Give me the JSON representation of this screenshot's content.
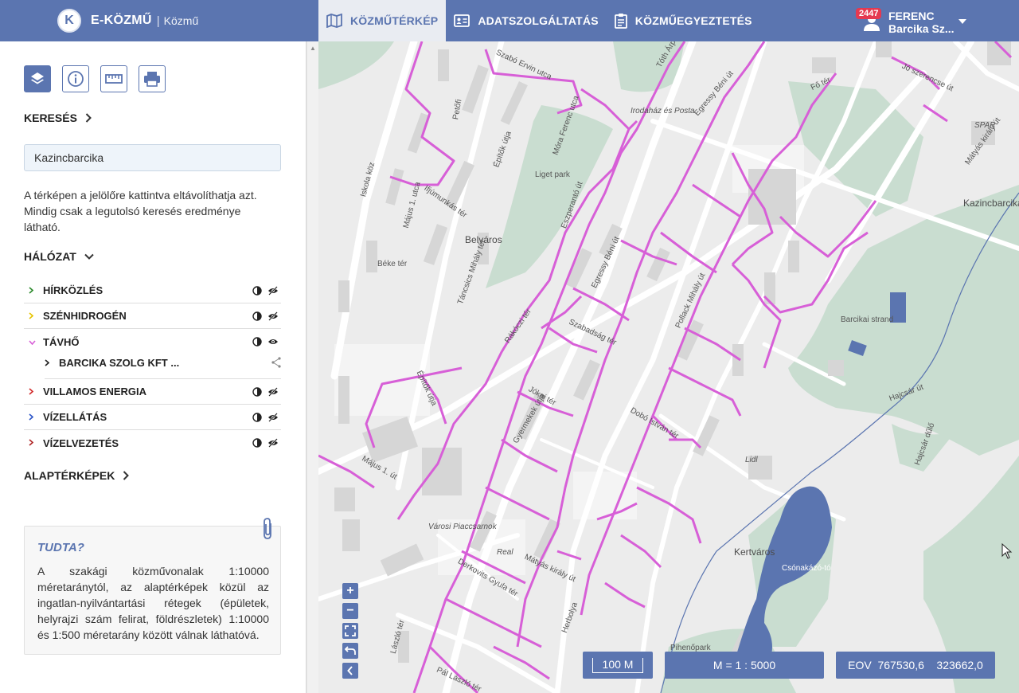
{
  "header": {
    "logo_letter": "K",
    "app_name": "E-KÖZMŰ",
    "separator": "|",
    "app_sub": "Közmű",
    "tabs": [
      {
        "label": "KÖZMŰTÉRKÉP",
        "icon": "map-icon",
        "active": true
      },
      {
        "label": "ADATSZOLGÁLTATÁS",
        "icon": "id-card-icon",
        "active": false
      },
      {
        "label": "KÖZMŰEGYEZTETÉS",
        "icon": "clipboard-icon",
        "active": false
      }
    ],
    "user": {
      "badge": "2447",
      "name": "FERENC",
      "org": "Barcika Sz..."
    }
  },
  "sidebar": {
    "tools": [
      "layers-icon",
      "info-icon",
      "ruler-icon",
      "print-icon"
    ],
    "search_title": "KERESÉS",
    "search_value": "Kazincbarcika",
    "info_text": "A térképen a jelölőre kattintva eltávolíthatja azt. Mindig csak a legutolsó keresés eredménye látható.",
    "network_title": "HÁLÓZAT",
    "layers": [
      {
        "label": "HÍRKÖZLÉS",
        "caret_color": "#2e8b2e",
        "visible": false
      },
      {
        "label": "SZÉNHIDROGÉN",
        "caret_color": "#e6c400",
        "visible": false
      },
      {
        "label": "TÁVHŐ",
        "caret_color": "#d75fd7",
        "visible": true
      },
      {
        "label": "VILLAMOS ENERGIA",
        "caret_color": "#d22c2c",
        "visible": false
      },
      {
        "label": "VÍZELLÁTÁS",
        "caret_color": "#2c56c8",
        "visible": false
      },
      {
        "label": "VÍZELVEZETÉS",
        "caret_color": "#b02828",
        "visible": false
      }
    ],
    "sublayer": {
      "label": "BARCIKA SZOLG KFT ..."
    },
    "basemaps_title": "ALAPTÉRKÉPEK",
    "tip": {
      "title": "TUDTA?",
      "text": "A szakági közművonalak 1:10000 méretaránytól, az alaptérképek közül az ingatlan-nyilvántartási rétegek (épületek, helyrajzi szám felirat, földrészletek) 1:10000 és 1:500 méretarány között válnak láthatóvá."
    }
  },
  "map": {
    "labels": [
      "Szabó Ervin utca",
      "Tóth Árp",
      "Egressy Béni út",
      "Irodaház és Posta",
      "Fő tér",
      "Jó szerencse út",
      "SPAR",
      "Mátyás király út",
      "Kazincbarcika",
      "Liget park",
      "Petőfi",
      "Építők útja",
      "Móra Ferenc utca",
      "Iskola köz",
      "Május 1. utca",
      "Ifjúmunkás tér",
      "Belváros",
      "Béke tér",
      "Táncsics Mihály tér",
      "Eszperantó út",
      "Rákóczi tér",
      "Egressy Béni út",
      "Szabadság tér",
      "Gyermekek útja",
      "Pollack Mihály út",
      "Barcikai strand",
      "Hajcsár út",
      "Hajcsár dűlő",
      "Lidl",
      "Dobó István tér",
      "Jókai tér",
      "Építők útja",
      "Május 1. út",
      "Városi Piaccsarnok",
      "Real",
      "Mátyás király út",
      "Derkovits Gyula tér",
      "Kertváros",
      "Csónakázó-tó",
      "Pihenőpark",
      "Herbolya",
      "László tér",
      "Pál László tér"
    ],
    "scale_bar": "100 M",
    "scale_ratio": "M = 1 : 5000",
    "coords": "EOV  767530,6    323662,0",
    "zoom_controls": [
      "zoom-in",
      "zoom-out",
      "fit-extent",
      "back",
      "collapse"
    ]
  }
}
